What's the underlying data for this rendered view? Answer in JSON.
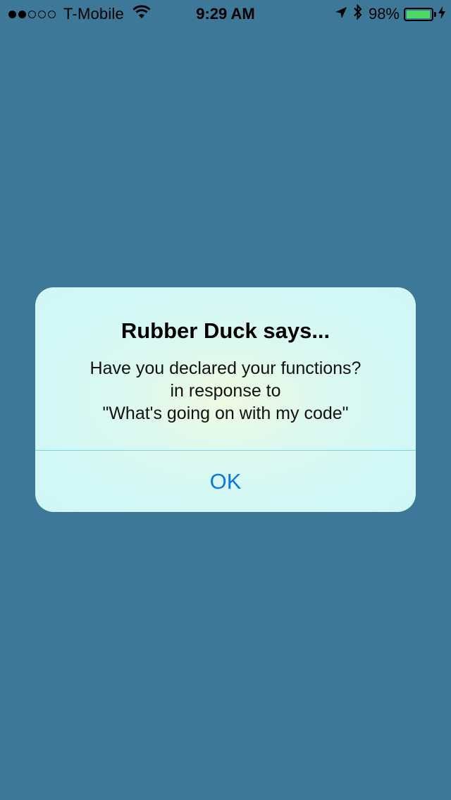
{
  "status_bar": {
    "carrier": "T-Mobile",
    "signal_bars_filled": 2,
    "signal_bars_total": 5,
    "time": "9:29 AM",
    "battery_percent": "98%",
    "battery_level": 0.98,
    "battery_color": "#4cd964",
    "icons": [
      "wifi-icon",
      "location-arrow-icon",
      "bluetooth-icon",
      "battery-icon",
      "charging-bolt-icon"
    ]
  },
  "alert": {
    "title": "Rubber Duck says...",
    "message_line1": "Have you declared your functions?",
    "message_line2": "in response to",
    "message_line3": "\"What's going on with my code\"",
    "ok_label": "OK",
    "button_color": "#0a78e0"
  },
  "background_color": "#3d7898"
}
